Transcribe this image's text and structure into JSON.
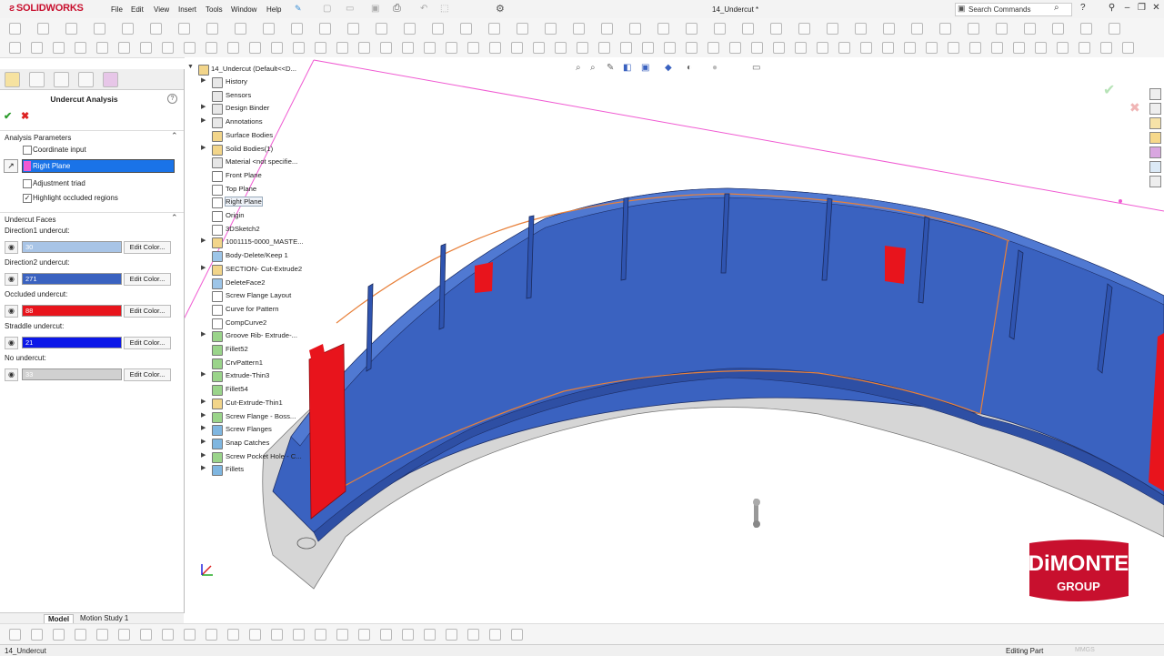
{
  "app": {
    "brand": "SOLIDWORKS",
    "document_title": "14_Undercut *"
  },
  "menu": [
    "File",
    "Edit",
    "View",
    "Insert",
    "Tools",
    "Window",
    "Help"
  ],
  "search": {
    "placeholder": "Search Commands"
  },
  "panel": {
    "title": "Undercut Analysis",
    "analysis_parameters": {
      "header": "Analysis Parameters",
      "coordinate_input": {
        "label": "Coordinate input",
        "checked": false
      },
      "plane": {
        "value": "Right Plane"
      },
      "adjustment_triad": {
        "label": "Adjustment triad",
        "checked": false
      },
      "highlight_occluded": {
        "label": "Highlight occluded regions",
        "checked": true
      }
    },
    "undercut_faces": {
      "header": "Undercut Faces",
      "rows": [
        {
          "label": "Direction1 undercut:",
          "count": "30",
          "color": "#a8c4e6",
          "button": "Edit Color..."
        },
        {
          "label": "Direction2 undercut:",
          "count": "271",
          "color": "#3a62c0",
          "button": "Edit Color..."
        },
        {
          "label": "Occluded undercut:",
          "count": "88",
          "color": "#e8141c",
          "button": "Edit Color..."
        },
        {
          "label": "Straddle undercut:",
          "count": "21",
          "color": "#0c18e8",
          "button": "Edit Color..."
        },
        {
          "label": "No undercut:",
          "count": "33",
          "color": "#d0d0d0",
          "button": "Edit Color..."
        }
      ]
    }
  },
  "tree": {
    "root": "14_Undercut  (Default<<D...",
    "items": [
      {
        "label": "History",
        "arrow": true,
        "icon": "history-icon",
        "color": "#e8e8e8"
      },
      {
        "label": "Sensors",
        "arrow": false,
        "icon": "sensors-icon",
        "color": "#e8e8e8"
      },
      {
        "label": "Design Binder",
        "arrow": true,
        "icon": "design-binder-icon",
        "color": "#e8e8e8"
      },
      {
        "label": "Annotations",
        "arrow": true,
        "icon": "annotations-icon",
        "color": "#e8e8e8"
      },
      {
        "label": "Surface Bodies",
        "arrow": false,
        "icon": "surface-bodies-icon",
        "color": "#f2d58a"
      },
      {
        "label": "Solid Bodies(1)",
        "arrow": true,
        "icon": "solid-bodies-icon",
        "color": "#f2d58a"
      },
      {
        "label": "Material <not specifie...",
        "arrow": false,
        "icon": "material-icon",
        "color": "#e6e6e6"
      },
      {
        "label": "Front Plane",
        "arrow": false,
        "icon": "plane-icon",
        "color": "#ffffff"
      },
      {
        "label": "Top Plane",
        "arrow": false,
        "icon": "plane-icon",
        "color": "#ffffff"
      },
      {
        "label": "Right Plane",
        "arrow": false,
        "icon": "plane-icon",
        "color": "#ffffff",
        "selected": true
      },
      {
        "label": "Origin",
        "arrow": false,
        "icon": "origin-icon",
        "color": "#ffffff"
      },
      {
        "label": "3DSketch2",
        "arrow": false,
        "icon": "sketch-3d-icon",
        "color": "#ffffff"
      },
      {
        "label": "1001115-0000_MASTE...",
        "arrow": true,
        "icon": "part-reference-icon",
        "color": "#f2d58a"
      },
      {
        "label": "Body-Delete/Keep 1",
        "arrow": false,
        "icon": "body-delete-icon",
        "color": "#9dc5e8"
      },
      {
        "label": "SECTION- Cut-Extrude2",
        "arrow": true,
        "icon": "cut-extrude-icon",
        "color": "#f2d58a"
      },
      {
        "label": "DeleteFace2",
        "arrow": false,
        "icon": "delete-face-icon",
        "color": "#9dc5e8"
      },
      {
        "label": "Screw Flange Layout",
        "arrow": false,
        "icon": "sketch-icon",
        "color": "#ffffff"
      },
      {
        "label": "Curve for Pattern",
        "arrow": false,
        "icon": "sketch-icon",
        "color": "#ffffff"
      },
      {
        "label": "CompCurve2",
        "arrow": false,
        "icon": "composite-curve-icon",
        "color": "#ffffff"
      },
      {
        "label": "Groove Rib- Extrude-...",
        "arrow": true,
        "icon": "extrude-icon",
        "color": "#9ad48a"
      },
      {
        "label": "Fillet52",
        "arrow": false,
        "icon": "fillet-icon",
        "color": "#9ad48a"
      },
      {
        "label": "CrvPattern1",
        "arrow": false,
        "icon": "curve-pattern-icon",
        "color": "#9ad48a"
      },
      {
        "label": "Extrude-Thin3",
        "arrow": true,
        "icon": "extrude-icon",
        "color": "#9ad48a"
      },
      {
        "label": "Fillet54",
        "arrow": false,
        "icon": "fillet-icon",
        "color": "#9ad48a"
      },
      {
        "label": "Cut-Extrude-Thin1",
        "arrow": true,
        "icon": "cut-extrude-icon",
        "color": "#f2d58a"
      },
      {
        "label": "Screw Flange - Boss...",
        "arrow": true,
        "icon": "boss-icon",
        "color": "#9ad48a"
      },
      {
        "label": "Screw Flanges",
        "arrow": true,
        "icon": "folder-icon",
        "color": "#7fb6e0"
      },
      {
        "label": "Snap Catches",
        "arrow": true,
        "icon": "folder-icon",
        "color": "#7fb6e0"
      },
      {
        "label": "Screw Pocket Hole - C...",
        "arrow": true,
        "icon": "hole-icon",
        "color": "#9ad48a"
      },
      {
        "label": "Fillets",
        "arrow": true,
        "icon": "folder-icon",
        "color": "#7fb6e0"
      }
    ]
  },
  "bottom_tabs": [
    "Model",
    "Motion Study 1"
  ],
  "status": {
    "document": "14_Undercut",
    "mode": "Editing Part",
    "units": "MMGS"
  },
  "watermark": {
    "line1": "DiMONTE",
    "line2": "GROUP"
  },
  "colors": {
    "direction2_blue": "#3a62c0",
    "occluded_red": "#e8141c",
    "no_undercut_grey": "#d0d0d0",
    "plane_magenta": "#f05ad2",
    "brand_red": "#c8102e"
  }
}
